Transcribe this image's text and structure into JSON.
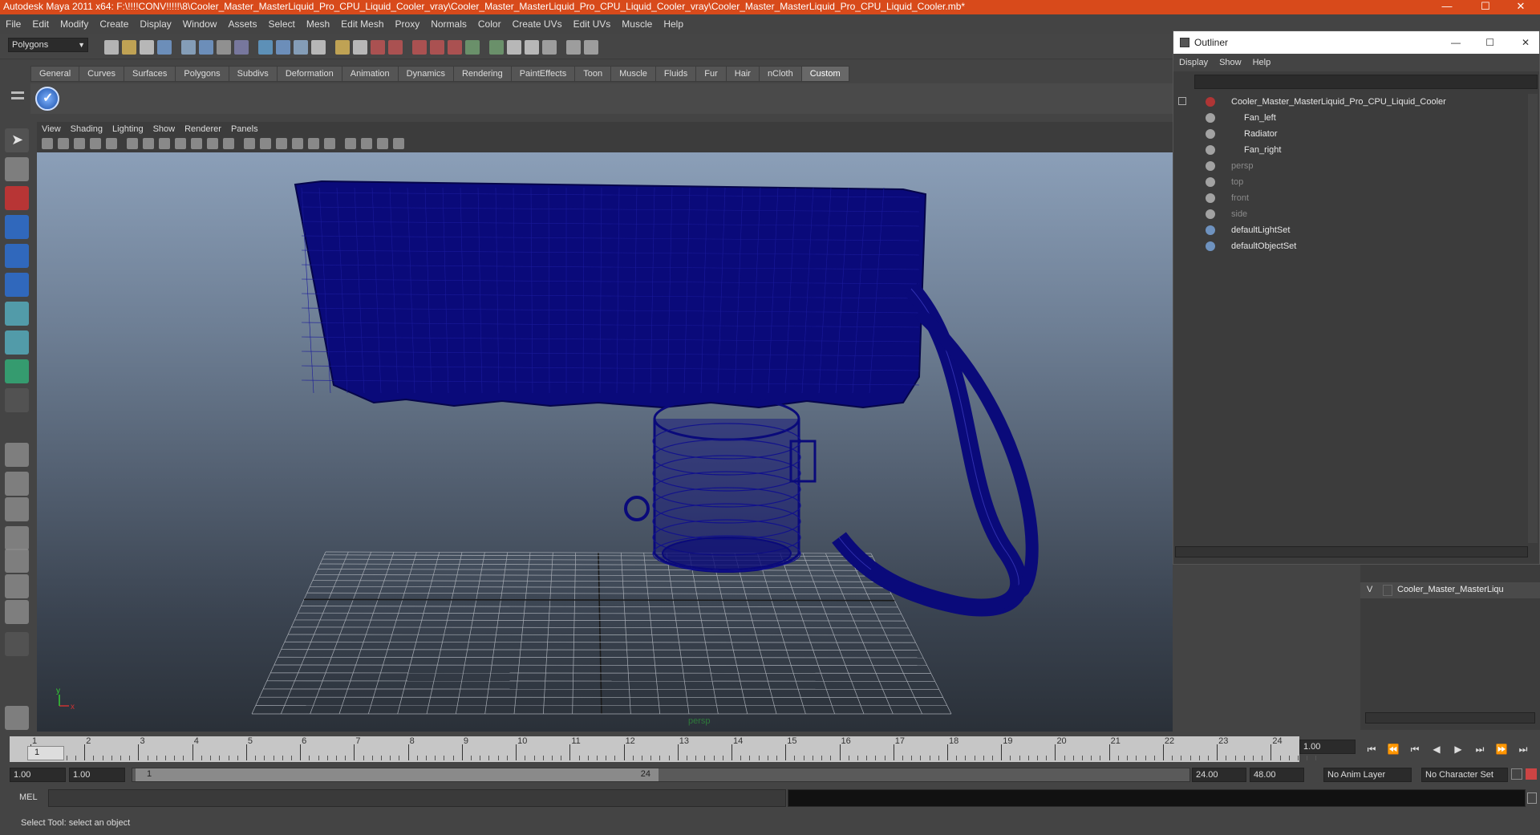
{
  "window": {
    "title": "Autodesk Maya 2011 x64: F:\\!!!!CONV!!!!!\\8\\Cooler_Master_MasterLiquid_Pro_CPU_Liquid_Cooler_vray\\Cooler_Master_MasterLiquid_Pro_CPU_Liquid_Cooler_vray\\Cooler_Master_MasterLiquid_Pro_CPU_Liquid_Cooler.mb*",
    "minimize": "—",
    "maximize": "☐",
    "close": "✕"
  },
  "menubar": [
    "File",
    "Edit",
    "Modify",
    "Create",
    "Display",
    "Window",
    "Assets",
    "Select",
    "Mesh",
    "Edit Mesh",
    "Proxy",
    "Normals",
    "Color",
    "Create UVs",
    "Edit UVs",
    "Muscle",
    "Help"
  ],
  "status_line": {
    "mode": "Polygons"
  },
  "shelf_tabs": [
    "General",
    "Curves",
    "Surfaces",
    "Polygons",
    "Subdivs",
    "Deformation",
    "Animation",
    "Dynamics",
    "Rendering",
    "PaintEffects",
    "Toon",
    "Muscle",
    "Fluids",
    "Fur",
    "Hair",
    "nCloth",
    "Custom"
  ],
  "shelf_active_tab": "Custom",
  "viewport": {
    "menu": [
      "View",
      "Shading",
      "Lighting",
      "Show",
      "Renderer",
      "Panels"
    ],
    "camera_label": "persp",
    "axis_x": "x",
    "axis_y": "y",
    "wire_color": "#0a0a7a"
  },
  "outliner": {
    "title": "Outliner",
    "menu": [
      "Display",
      "Show",
      "Help"
    ],
    "items": [
      {
        "label": "Cooler_Master_MasterLiquid_Pro_CPU_Liquid_Cooler",
        "dim": false
      },
      {
        "label": "Fan_left",
        "dim": false
      },
      {
        "label": "Radiator",
        "dim": false
      },
      {
        "label": "Fan_right",
        "dim": false
      },
      {
        "label": "persp",
        "dim": true
      },
      {
        "label": "top",
        "dim": true
      },
      {
        "label": "front",
        "dim": true
      },
      {
        "label": "side",
        "dim": true
      },
      {
        "label": "defaultLightSet",
        "dim": false
      },
      {
        "label": "defaultObjectSet",
        "dim": false
      }
    ]
  },
  "layer_editor": {
    "visible_flag": "V",
    "layer_name": "Cooler_Master_MasterLiqu"
  },
  "time_slider": {
    "ticks": [
      "1",
      "2",
      "3",
      "4",
      "5",
      "6",
      "7",
      "8",
      "9",
      "10",
      "11",
      "12",
      "13",
      "14",
      "15",
      "16",
      "17",
      "18",
      "19",
      "20",
      "21",
      "22",
      "23",
      "24"
    ],
    "current_frame": "1",
    "current_time_field": "1.00"
  },
  "range_slider": {
    "start_time": "1.00",
    "playback_start": "1.00",
    "range_start_label": "1",
    "range_end_label": "24",
    "playback_end": "24.00",
    "end_time": "48.00",
    "anim_layer": "No Anim Layer",
    "character_set": "No Character Set"
  },
  "command_line": {
    "label": "MEL"
  },
  "help_line": {
    "text": "Select Tool: select an object"
  }
}
